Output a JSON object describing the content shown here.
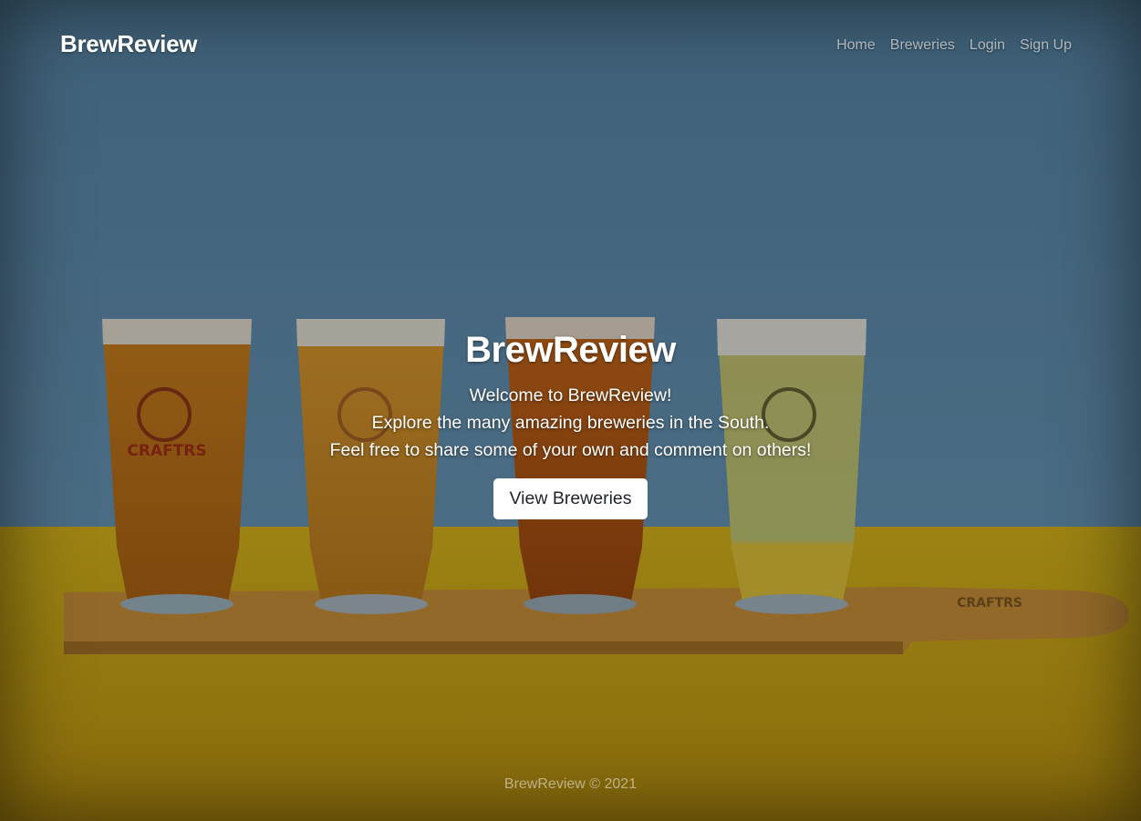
{
  "navbar": {
    "brand": "BrewReview",
    "links": [
      "Home",
      "Breweries",
      "Login",
      "Sign Up"
    ]
  },
  "hero": {
    "title": "BrewReview",
    "lines": [
      "Welcome to BrewReview!",
      "Explore the many amazing breweries in the South.",
      "Feel free to share some of your own and comment on others!"
    ],
    "button_label": "View Breweries"
  },
  "background": {
    "glass_logo_text": "CRAFTRS",
    "paddle_text": "CRAFTRS"
  },
  "footer": {
    "text": "BrewReview © 2021"
  }
}
